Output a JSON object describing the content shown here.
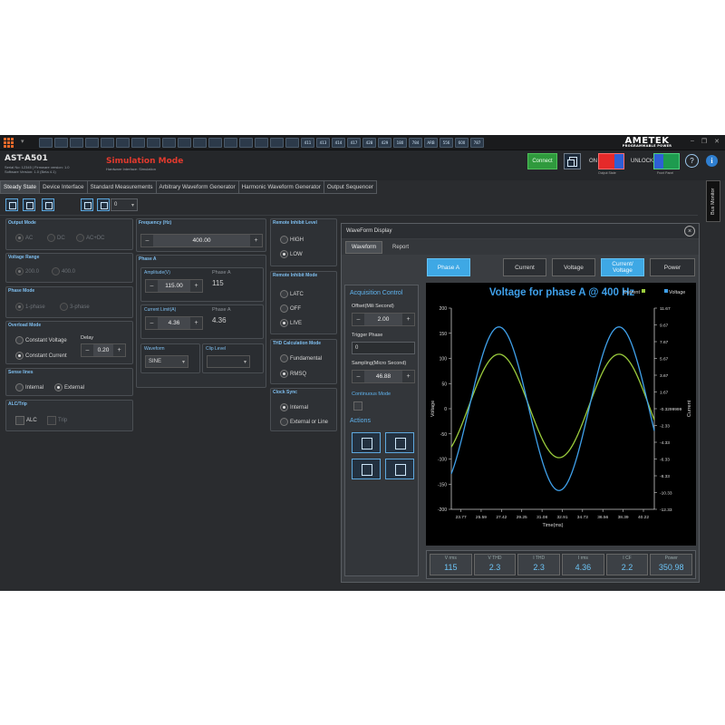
{
  "titlebar": {
    "logo": "AMETEK",
    "logo_sub": "PROGRAMMABLE POWER",
    "toolbar_icons": [
      "",
      "",
      "",
      "",
      "",
      "",
      "",
      "",
      "",
      "",
      "",
      "",
      "",
      "",
      "",
      "",
      "",
      "411",
      "413",
      "414",
      "417",
      "428",
      "429",
      "180",
      "784",
      "ARB",
      "556",
      "600",
      "787"
    ]
  },
  "header": {
    "model": "AST-A501",
    "serial_line": "Serial No: 12345 | Firmware version: 1.0",
    "software_line": "Software Version: 1.0 (Beta 4.1)",
    "mode_title": "Simulation Mode",
    "mode_sub": "Hardware Interface: Simulation",
    "connect_label": "Connect",
    "on_label": "ON",
    "unlock_label": "UNLOCK",
    "output_state_cap": "Output State",
    "front_panel_cap": "Front Panel",
    "help": "?",
    "info": "i"
  },
  "tabs": [
    "Steady State",
    "Device Interface",
    "Standard Measurements",
    "Arbitrary Waveform Generator",
    "Harmonic Waveform Generator",
    "Output Sequencer"
  ],
  "bus_monitor": "Bus Monitor",
  "toolbar": {
    "select_value": "0"
  },
  "output_mode": {
    "title": "Output Mode",
    "options": [
      "AC",
      "DC",
      "AC+DC"
    ]
  },
  "voltage_range": {
    "title": "Voltage Range",
    "options": [
      "200.0",
      "400.0"
    ]
  },
  "phase_mode": {
    "title": "Phase Mode",
    "options": [
      "1-phase",
      "3-phase"
    ]
  },
  "overload_mode": {
    "title": "Overload Mode",
    "opt1": "Constant Voltage",
    "opt2": "Constant Current",
    "delay_label": "Delay",
    "delay_value": "0.20"
  },
  "sense_lines": {
    "title": "Sense lines",
    "opt1": "Internal",
    "opt2": "External"
  },
  "alc_trip": {
    "title": "ALC/Trip",
    "opt1": "ALC",
    "opt2": "Trip"
  },
  "frequency": {
    "title": "Frequency (Hz)",
    "value": "400.00"
  },
  "phase_a": {
    "title": "Phase A",
    "amplitude_label": "Amplitude(V)",
    "amplitude_value": "115.00",
    "phase_a_label": "Phase A",
    "phase_a_amp": "115",
    "current_limit_label": "Current Limit(A)",
    "current_limit_value": "4.36",
    "phase_a_label2": "Phase A",
    "phase_a_cur": "4.36",
    "waveform_label": "Waveform",
    "waveform_value": "SINE",
    "clip_label": "Clip Level",
    "clip_value": ""
  },
  "remote_inhibit_level": {
    "title": "Remote Inhibit Level",
    "opt1": "HIGH",
    "opt2": "LOW"
  },
  "remote_inhibit_mode": {
    "title": "Remote Inhibit Mode",
    "opt1": "LATC",
    "opt2": "OFF",
    "opt3": "LIVE"
  },
  "thd_mode": {
    "title": "THD Calculation Mode",
    "opt1": "Fundamental",
    "opt2": "RMSQ"
  },
  "clock_sync": {
    "title": "Clock Sync",
    "opt1": "Internal",
    "opt2": "External or Line"
  },
  "waveform_display": {
    "title": "WaveForm Display",
    "close": "×",
    "tabs": [
      "Waveform",
      "Report"
    ],
    "phase_btn": "Phase A",
    "buttons": [
      "Current",
      "Voltage",
      "Current/ Voltage",
      "Power"
    ],
    "acq_title": "Acquisition Control",
    "offset_label": "Offset(Mili Second)",
    "offset_value": "2.00",
    "trigger_label": "Trigger Phase",
    "trigger_value": "0",
    "sampling_label": "Sampling(Micro Second)",
    "sampling_value": "46.88",
    "continuous_label": "Continuous Mode",
    "actions_label": "Actions",
    "stats": [
      {
        "label": "V rms",
        "value": "115"
      },
      {
        "label": "V THD",
        "value": "2.3"
      },
      {
        "label": "I THD",
        "value": "2.3"
      },
      {
        "label": "I rms",
        "value": "4.36"
      },
      {
        "label": "I CF",
        "value": "2.2"
      },
      {
        "label": "Power",
        "value": "350.98"
      }
    ]
  },
  "chart_data": {
    "type": "line",
    "title": "Voltage for phase A @ 400 Hz",
    "xlabel": "Time(ms)",
    "ylabel": "Voltage",
    "y2label": "Current",
    "x_ticks": [
      "23.77",
      "25.59",
      "27.42",
      "29.25",
      "31.08",
      "32.91",
      "34.73",
      "36.56",
      "38.39",
      "40.22"
    ],
    "y_ticks": [
      "200",
      "150",
      "100",
      "50",
      "0",
      "-50",
      "-100",
      "-150",
      "-200"
    ],
    "y2_ticks": [
      "11.67",
      "9.67",
      "7.67",
      "5.67",
      "3.67",
      "1.67",
      "-0.3299999",
      "-2.33",
      "-4.33",
      "-6.33",
      "-8.33",
      "-10.33",
      "-12.33"
    ],
    "xlim": [
      22.9,
      41.2
    ],
    "ylim": [
      -200,
      200
    ],
    "y2lim": [
      -12.33,
      11.67
    ],
    "legend": [
      "Current",
      "Voltage"
    ],
    "legend_position": "top-right",
    "colors": {
      "voltage": "#3fa0ea",
      "current": "#9acb3c"
    },
    "series": [
      {
        "name": "Voltage",
        "amplitude": 162.6,
        "period_ms": 2.5
      },
      {
        "name": "Current",
        "amplitude": 6.17,
        "period_ms": 2.5
      }
    ]
  }
}
